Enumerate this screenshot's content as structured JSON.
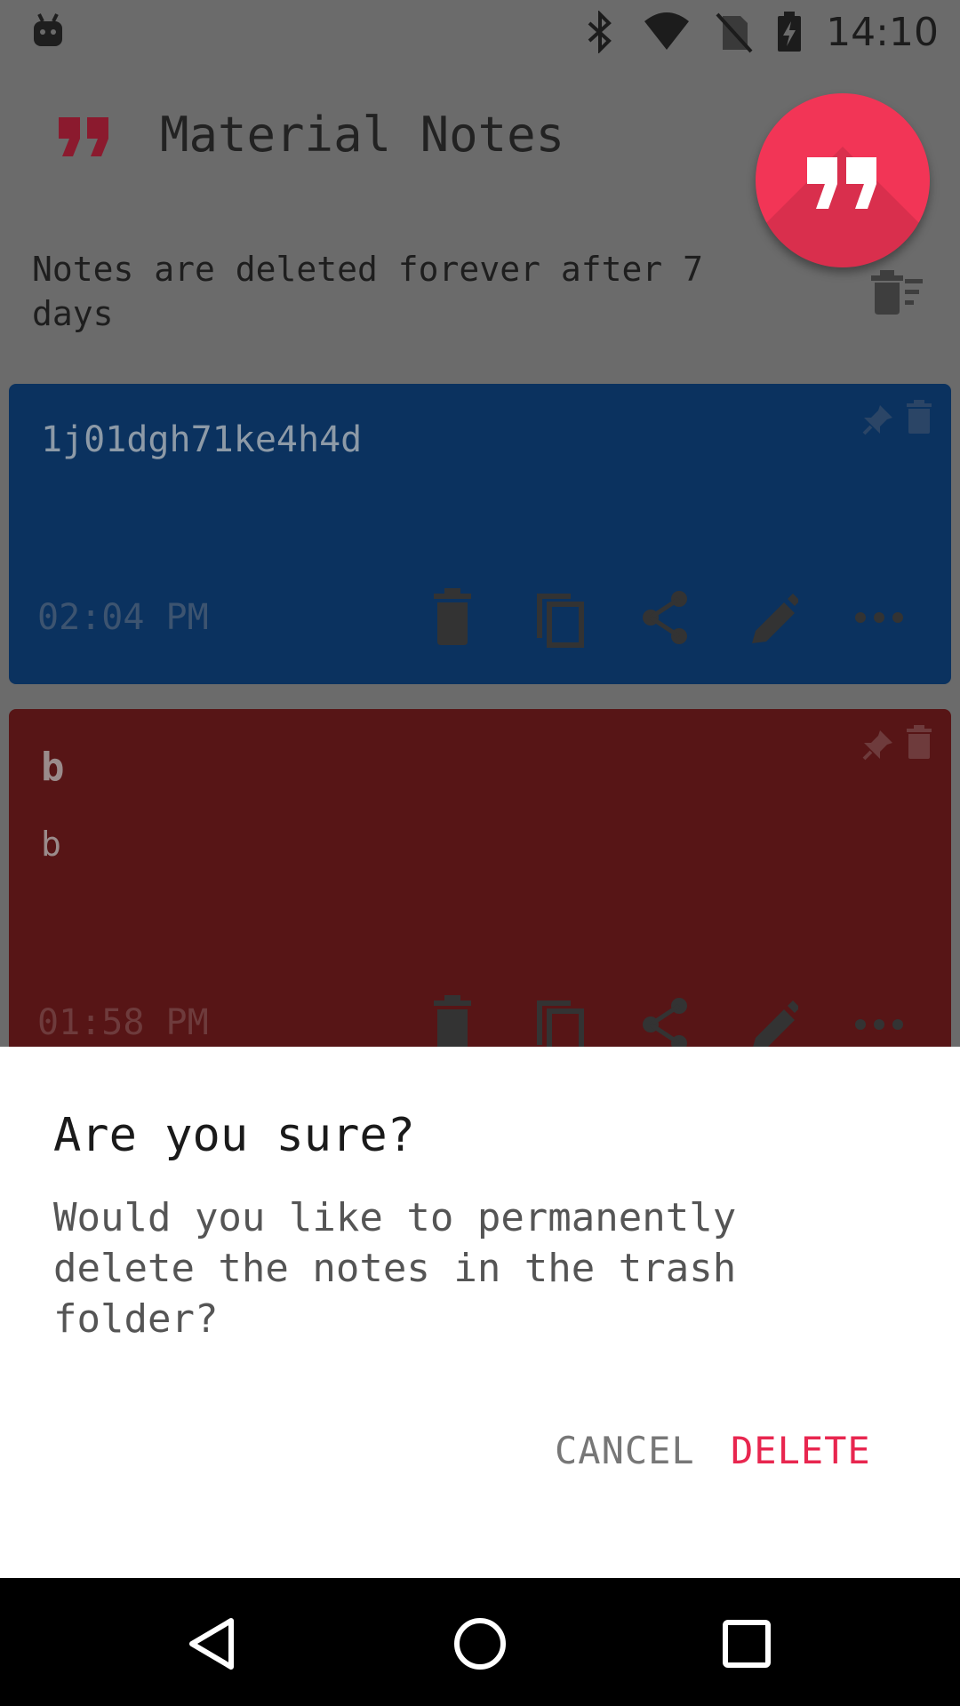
{
  "status_bar": {
    "time": "14:10",
    "icons": [
      "android-icon",
      "bluetooth-icon",
      "wifi-icon",
      "no-sim-icon",
      "battery-charging-icon"
    ]
  },
  "app_bar": {
    "title": "Material Notes",
    "logo_icon": "quote-icon",
    "fab_icon": "quote-icon",
    "colors": {
      "accent": "#f23556",
      "logo": "#8b1a2e"
    }
  },
  "trash_info": {
    "text": "Notes are deleted forever after 7 days",
    "icon": "delete-all-icon"
  },
  "notes": [
    {
      "text": "1j01dgh71ke4h4d",
      "time": "02:04 PM",
      "color": "#0b325f",
      "actions": [
        "delete-icon",
        "copy-icon",
        "share-icon",
        "edit-icon",
        "more-icon"
      ]
    },
    {
      "title": "b",
      "body": "b",
      "time": "01:58 PM",
      "color": "#571516",
      "actions": [
        "delete-icon",
        "copy-icon",
        "share-icon",
        "edit-icon",
        "more-icon"
      ]
    }
  ],
  "dialog": {
    "title": "Are you sure?",
    "message": "Would you like to permanently delete the notes in the trash folder?",
    "cancel_label": "CANCEL",
    "delete_label": "DELETE"
  },
  "nav_bar": {
    "icons": [
      "back-icon",
      "home-icon",
      "recents-icon"
    ]
  }
}
